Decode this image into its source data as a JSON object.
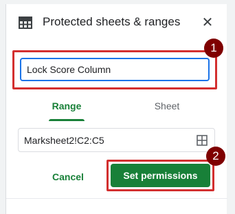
{
  "panel": {
    "title": "Protected sheets & ranges",
    "close_glyph": "✕",
    "title_icon": "sheet-grid-icon"
  },
  "name_input": {
    "value": "Lock Score Column"
  },
  "tabs": [
    {
      "label": "Range",
      "active": true
    },
    {
      "label": "Sheet",
      "active": false
    }
  ],
  "range_input": {
    "value": "Marksheet2!C2:C5",
    "icon": "select-range-icon"
  },
  "actions": {
    "cancel_label": "Cancel",
    "set_permissions_label": "Set permissions"
  },
  "annotations": {
    "badge_1": "1",
    "badge_2": "2"
  },
  "colors": {
    "accent_green": "#188038",
    "focus_blue": "#1a73e8",
    "highlight_red": "#d32f2f",
    "badge_maroon": "#7f0000"
  }
}
